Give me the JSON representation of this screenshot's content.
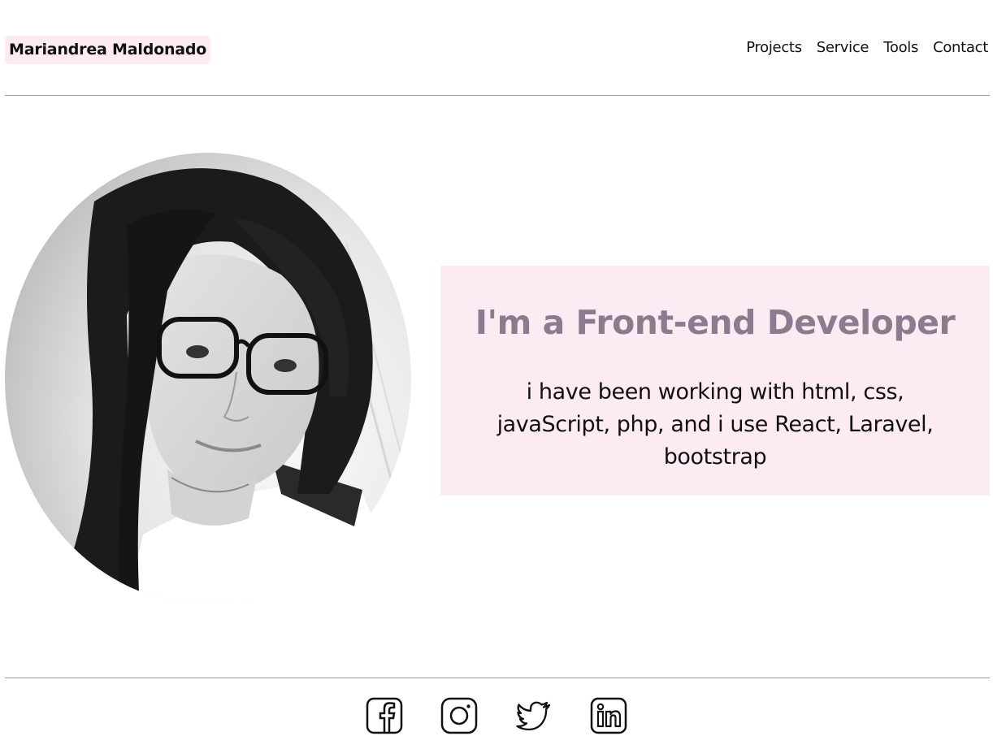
{
  "header": {
    "brand": "Mariandrea Maldonado",
    "nav": [
      "Projects",
      "Service",
      "Tools",
      "Contact"
    ]
  },
  "hero": {
    "title": "I'm a Front-end Developer",
    "description": "i have been working with html, css, javaScript, php, and i use React, Laravel, bootstrap"
  },
  "socials": [
    "facebook-icon",
    "instagram-icon",
    "twitter-icon",
    "linkedin-icon"
  ],
  "colors": {
    "accent_bg": "#fdebf3",
    "title": "#8c7b8f",
    "divider": "#9a9a9a"
  }
}
